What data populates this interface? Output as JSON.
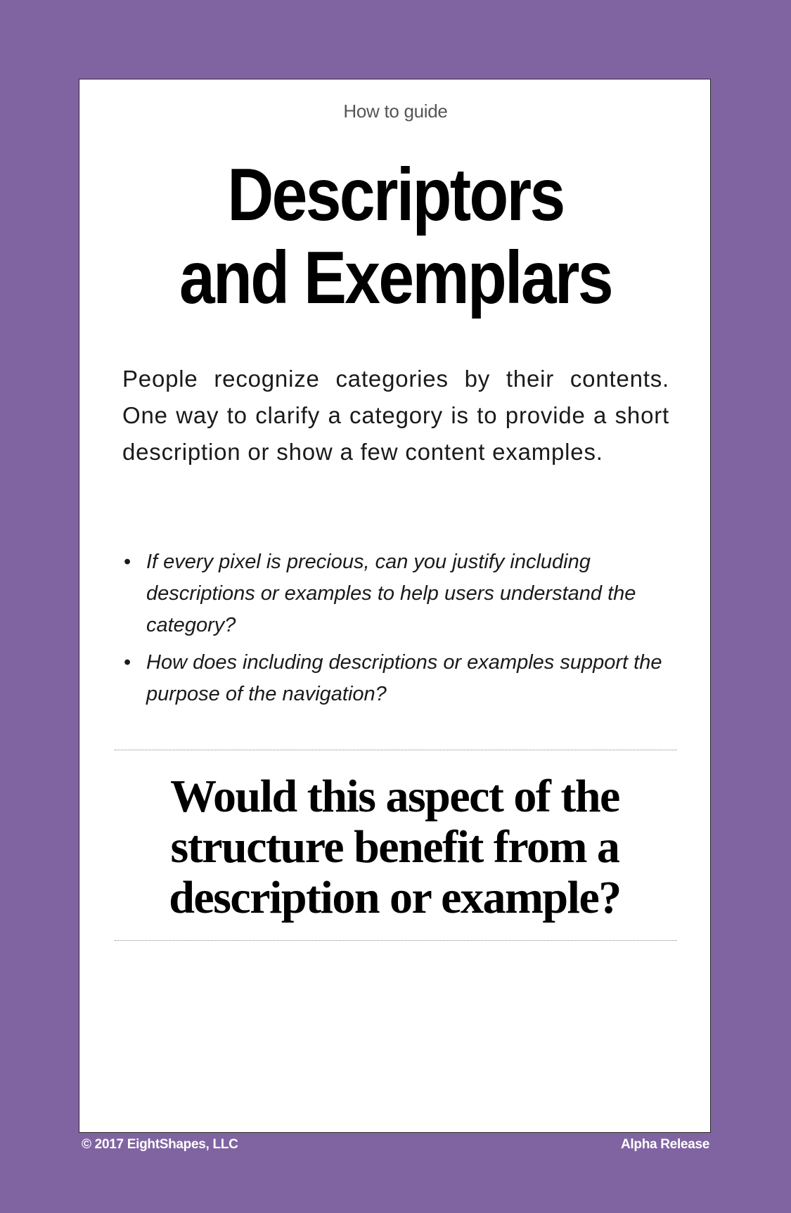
{
  "header": {
    "eyebrow": "How to guide",
    "title_line1": "Descriptors",
    "title_line2": "and Exemplars"
  },
  "intro": "People recognize categories by their contents. One way to clarify a category is to provide a short description or show a few content examples.",
  "questions": [
    "If every pixel is precious, can you justify including descriptions or examples to help users understand the category?",
    "How does including descriptions or examples support the purpose of the navigation?"
  ],
  "prompt": {
    "line1": "Would this aspect of the",
    "line2": "structure benefit from a",
    "line3": "description or example?"
  },
  "footer": {
    "copyright": "© 2017 EightShapes, LLC",
    "release": "Alpha Release"
  },
  "colors": {
    "background": "#8064a2",
    "card": "#ffffff",
    "text": "#000000"
  }
}
